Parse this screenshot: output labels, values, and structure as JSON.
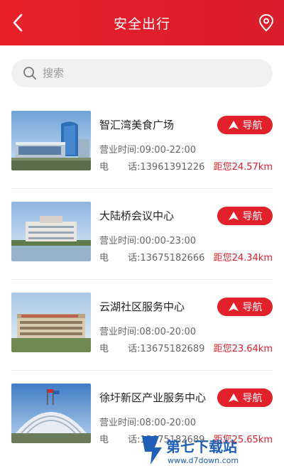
{
  "header": {
    "title": "安全出行"
  },
  "search": {
    "placeholder": "搜索"
  },
  "places": [
    {
      "name": "智汇湾美食广场",
      "hours": "营业时间:09:00-22:00",
      "phone_label_1": "电",
      "phone_label_2": "话:",
      "phone": "13961391226",
      "nav_label": "导航",
      "distance": "距您24.57km"
    },
    {
      "name": "大陆桥会议中心",
      "hours": "营业时间:00:00-23:00",
      "phone_label_1": "电",
      "phone_label_2": "话:",
      "phone": "13675182666",
      "nav_label": "导航",
      "distance": "距您24.34km"
    },
    {
      "name": "云湖社区服务中心",
      "hours": "营业时间:08:00-20:00",
      "phone_label_1": "电",
      "phone_label_2": "话:",
      "phone": "13675182689",
      "nav_label": "导航",
      "distance": "距您23.64km"
    },
    {
      "name": "徐圩新区产业服务中心",
      "hours": "营业时间:08:00-20:00",
      "phone_label_1": "电",
      "phone_label_2": "话:",
      "phone": "13675182689",
      "nav_label": "导航",
      "distance": "距您25.65km"
    }
  ],
  "watermark": {
    "brand": "第七下载站",
    "url": "www.d7down.com"
  },
  "colors": {
    "accent": "#e3212b",
    "distance": "#d81e2a"
  }
}
